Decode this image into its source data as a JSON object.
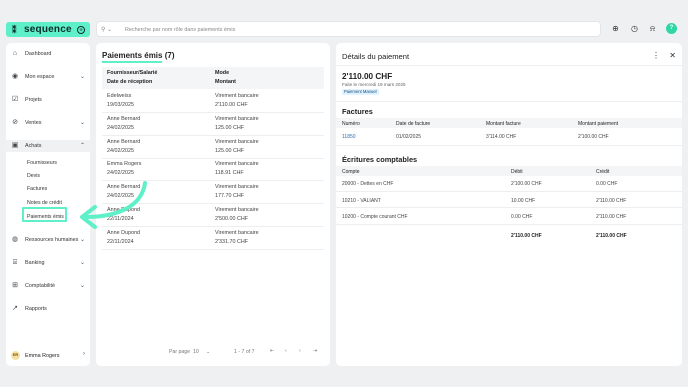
{
  "app": {
    "logo_text": "sequence",
    "logo_mark": "⁑",
    "logo_circle": "⊕"
  },
  "search": {
    "placeholder": "Recherche par nom rôle dans paiements émis",
    "icon": "search-icon"
  },
  "topbar": {
    "user_initials": "?"
  },
  "sidebar": {
    "items": [
      {
        "label": "Dashboard",
        "icon": "home-icon",
        "glyph": "⌂"
      },
      {
        "label": "Mon espace",
        "icon": "user-icon",
        "glyph": "◉"
      },
      {
        "label": "Projets",
        "icon": "check-square-icon",
        "glyph": "☑"
      },
      {
        "label": "Ventes",
        "icon": "sales-icon",
        "glyph": "⊘"
      },
      {
        "label": "Achats",
        "icon": "bag-icon",
        "glyph": "▣"
      },
      {
        "label": "Ressources humaines",
        "icon": "people-icon",
        "glyph": "◍"
      },
      {
        "label": "Banking",
        "icon": "bank-icon",
        "glyph": "⌸"
      },
      {
        "label": "Comptabilité",
        "icon": "calculator-icon",
        "glyph": "⊞"
      },
      {
        "label": "Rapports",
        "icon": "chart-icon",
        "glyph": "↗"
      }
    ],
    "submenu": [
      "Fournisseurs",
      "Devis",
      "Factures",
      "Notes de crédit",
      "Paiements émis"
    ],
    "user": {
      "initials": "ER",
      "name": "Emma Rogers"
    }
  },
  "list": {
    "title": "Paiements émis (7)",
    "col1_h1": "Fournisseur/Salarié",
    "col1_h2": "Date de réception",
    "col2_h1": "Mode",
    "col2_h2": "Montant",
    "rows": [
      {
        "name": "Edelweiss",
        "date": "19/03/2025",
        "mode": "Virement bancaire",
        "amount": "2'110.00 CHF"
      },
      {
        "name": "Anne Bernard",
        "date": "24/02/2025",
        "mode": "Virement bancaire",
        "amount": "125.00 CHF"
      },
      {
        "name": "Anne Bernard",
        "date": "24/02/2025",
        "mode": "Virement bancaire",
        "amount": "125.00 CHF"
      },
      {
        "name": "Emma Rogers",
        "date": "24/02/2025",
        "mode": "Virement bancaire",
        "amount": "118.91 CHF"
      },
      {
        "name": "Anne Bernard",
        "date": "24/02/2025",
        "mode": "Virement bancaire",
        "amount": "177.70 CHF"
      },
      {
        "name": "Anne Dupond",
        "date": "22/11/2024",
        "mode": "Virement bancaire",
        "amount": "2'500.00 CHF"
      },
      {
        "name": "Anne Dupond",
        "date": "22/11/2024",
        "mode": "Virement bancaire",
        "amount": "2'331.70 CHF"
      }
    ],
    "pager": {
      "per_page_label": "Par page",
      "per_page_value": "10",
      "range": "1 - 7 of 7"
    }
  },
  "detail": {
    "title": "Détails du paiement",
    "amount": "2'110.00 CHF",
    "subtitle": "Faite le mercredi 19 mars 2025",
    "badge": "Paiement Manuel",
    "factures": {
      "title": "Factures",
      "headers": [
        "Numéro",
        "Date de facture",
        "Montant facture",
        "Montant paiement"
      ],
      "rows": [
        [
          "11850",
          "01/02/2025",
          "3'114.00 CHF",
          "2'100.00 CHF"
        ]
      ]
    },
    "ecritures": {
      "title": "Écritures comptables",
      "headers": [
        "Compte",
        "Débit",
        "Crédit"
      ],
      "rows": [
        [
          "20000 - Dettes en CHF",
          "2'100.00 CHF",
          "0.00 CHF"
        ],
        [
          "10210 - VALIANT",
          "10.00 CHF",
          "2'110.00 CHF"
        ],
        [
          "10200 - Compte courant CHF",
          "0.00 CHF",
          "2'110.00 CHF"
        ]
      ],
      "totals": [
        "2'110.00 CHF",
        "2'110.00 CHF"
      ]
    }
  },
  "colors": {
    "accent": "#5ef0c8",
    "link": "#2a6fb5"
  }
}
